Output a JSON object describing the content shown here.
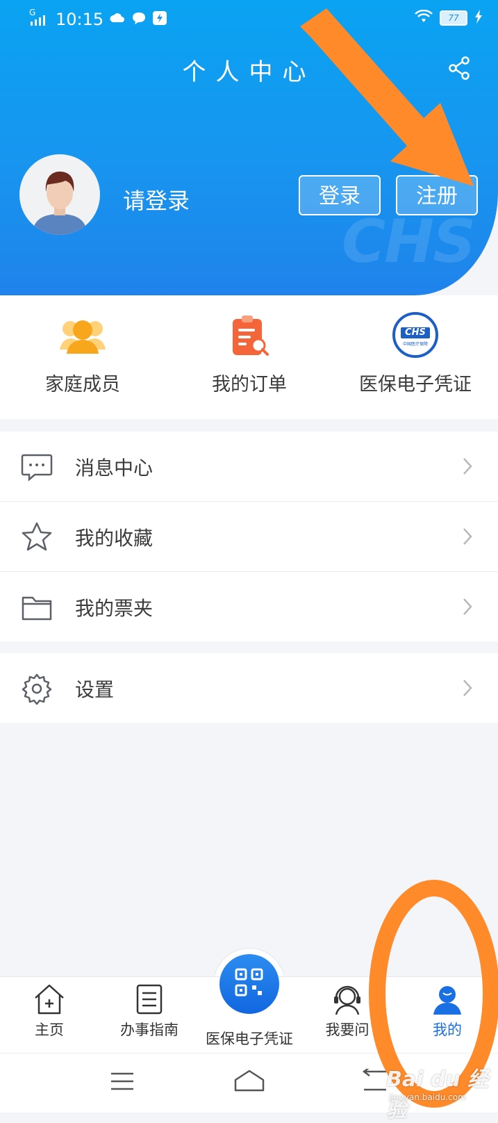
{
  "status_bar": {
    "time": "10:15",
    "signal_label": "G",
    "battery": "77"
  },
  "header": {
    "title": "个人中心",
    "login_prompt": "请登录",
    "login_button": "登录",
    "register_button": "注册",
    "watermark": "CHS"
  },
  "quick_actions": [
    {
      "label": "家庭成员",
      "icon": "family-members-icon"
    },
    {
      "label": "我的订单",
      "icon": "order-list-icon"
    },
    {
      "label": "医保电子凭证",
      "icon": "chs-badge-icon",
      "badge_text": "CHS",
      "badge_subtext": "中国医疗保障"
    }
  ],
  "menu_sections": [
    {
      "items": [
        {
          "label": "消息中心",
          "icon": "message-icon"
        },
        {
          "label": "我的收藏",
          "icon": "star-icon"
        },
        {
          "label": "我的票夹",
          "icon": "folder-icon"
        }
      ]
    },
    {
      "items": [
        {
          "label": "设置",
          "icon": "gear-icon"
        }
      ]
    }
  ],
  "tab_bar": {
    "tabs": [
      {
        "label": "主页",
        "icon": "home-plus-icon",
        "active": false
      },
      {
        "label": "办事指南",
        "icon": "guide-document-icon",
        "active": false
      },
      {
        "label": "医保电子凭证",
        "icon": "qr-code-icon",
        "active": false
      },
      {
        "label": "我要问",
        "icon": "headset-agent-icon",
        "active": false
      },
      {
        "label": "我的",
        "icon": "user-profile-icon",
        "active": true
      }
    ]
  },
  "colors": {
    "header_blue": "#1795ef",
    "active_tab": "#1a6fe3",
    "annotation_orange": "#ff8a2a"
  },
  "watermark": {
    "brand": "Bai du 经验",
    "url": "jingyan.baidu.com"
  }
}
